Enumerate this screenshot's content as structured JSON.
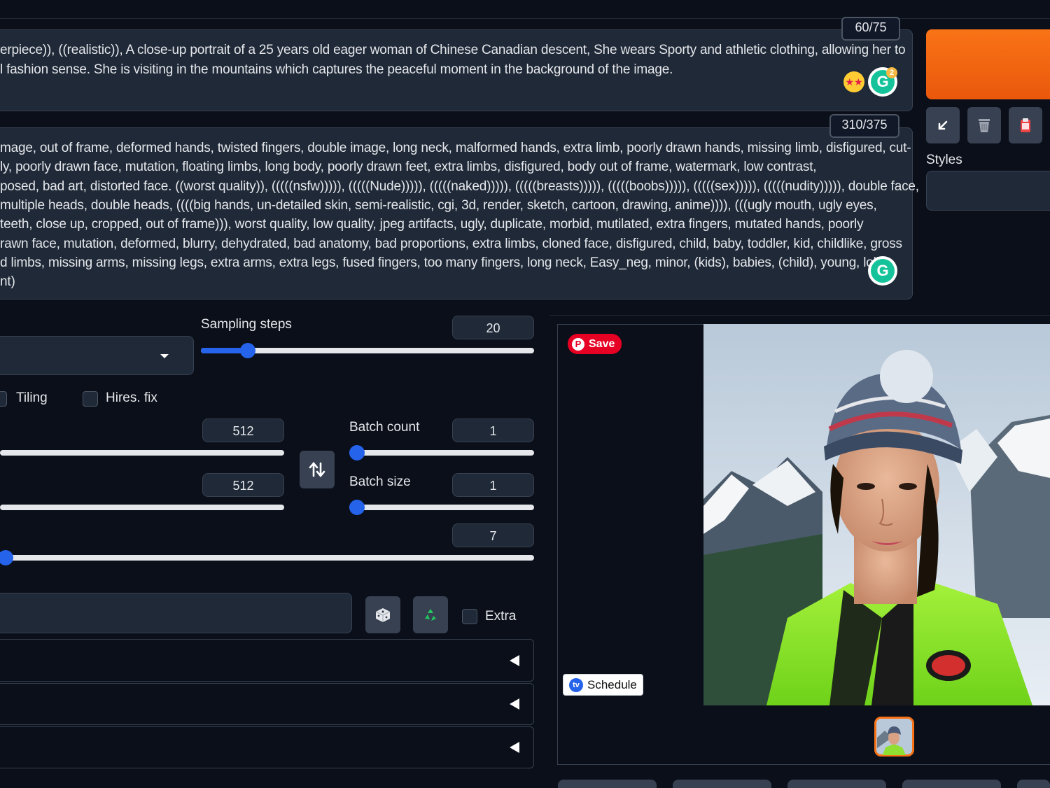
{
  "prompt": {
    "counter": "60/75",
    "lines": [
      "erpiece)), ((realistic)), A close-up portrait of a 25 years old eager woman of Chinese Canadian descent, She wears Sporty and athletic clothing, allowing her to",
      "l fashion sense. She is visiting in the mountains which captures the peaceful moment in the background of the image."
    ],
    "grammarly_badge": "2"
  },
  "negative_prompt": {
    "counter": "310/375",
    "lines": [
      "mage, out of frame, deformed hands, twisted fingers, double image, long neck, malformed hands, extra limb, poorly drawn hands, missing limb, disfigured, cut-",
      "ly, poorly drawn face, mutation, floating limbs, long body, poorly drawn feet, extra limbs, disfigured, body out of frame, watermark, low contrast,",
      "posed, bad art, distorted face. ((worst quality)), (((((nsfw))))), (((((Nude))))), (((((naked))))), (((((breasts))))), (((((boobs))))), (((((sex))))), (((((nudity))))), double face,",
      "multiple heads, double heads, ((((big hands, un-detailed skin, semi-realistic, cgi, 3d, render, sketch, cartoon, drawing, anime)))), (((ugly mouth, ugly eyes,",
      " teeth, close up, cropped, out of frame))), worst quality, low quality, jpeg artifacts, ugly, duplicate, morbid, mutilated, extra fingers, mutated hands, poorly",
      "rawn face, mutation, deformed, blurry, dehydrated, bad anatomy, bad proportions, extra limbs, cloned face, disfigured, child, baby, toddler, kid, childlike, gross",
      "d limbs, missing arms, missing legs, extra arms, extra legs, fused fingers, too many fingers, long neck, Easy_neg, minor, (kids), babies, (child), young, loli,",
      "nt)"
    ]
  },
  "side": {
    "styles_label": "Styles",
    "buttons": [
      "arrow-icon",
      "trash-icon",
      "clipboard-icon"
    ]
  },
  "settings": {
    "sampling_steps": {
      "label": "Sampling steps",
      "value": "20",
      "fraction": 0.14
    },
    "tiling_label": "Tiling",
    "hires_label": "Hires. fix",
    "width": {
      "value": "512"
    },
    "height": {
      "value": "512"
    },
    "batch_count": {
      "label": "Batch count",
      "value": "1",
      "fraction": 0
    },
    "batch_size": {
      "label": "Batch size",
      "value": "1",
      "fraction": 0
    },
    "cfg": {
      "value": "7"
    },
    "extra_label": "Extra"
  },
  "gallery": {
    "save_label": "Save",
    "schedule_label": "Schedule"
  },
  "colors": {
    "accent": "#2563eb",
    "generate": "#f97316"
  }
}
